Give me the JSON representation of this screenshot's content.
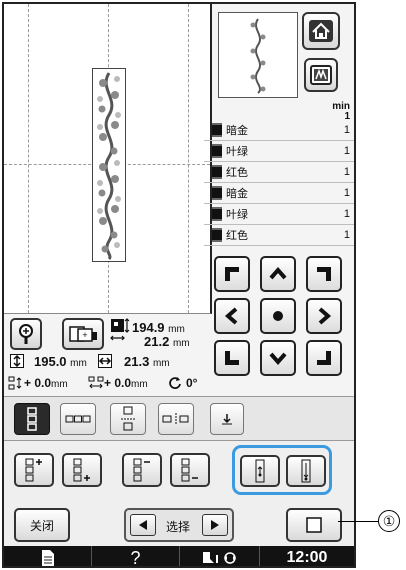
{
  "colors": {
    "accent_group_border": "#3b9ae0",
    "status_bar_bg": "#121212",
    "screen_bg": "#f4f4f4"
  },
  "icons": {
    "home": "home-icon",
    "mode": "embroidery-mode-icon",
    "magnifier": "magnifier-icon",
    "preview": "preview-icon",
    "pattern_size": "pattern-size-icon",
    "height": "vertical-size-icon",
    "width": "horizontal-size-icon",
    "spacing_v": "vertical-spacing-icon",
    "spacing_h": "horizontal-spacing-icon",
    "rotate": "rotate-icon",
    "status_doc": "document-icon",
    "status_help": "help-icon",
    "status_sensor": "presser-foot-sensor-icon"
  },
  "color_list": {
    "min_label": "min",
    "total_min": "1",
    "rows": [
      {
        "name": "暗金",
        "minutes": "1"
      },
      {
        "name": "叶绿",
        "minutes": "1"
      },
      {
        "name": "红色",
        "minutes": "1"
      },
      {
        "name": "暗金",
        "minutes": "1"
      },
      {
        "name": "叶绿",
        "minutes": "1"
      },
      {
        "name": "红色",
        "minutes": "1"
      }
    ]
  },
  "pattern_size": {
    "height": "194.9",
    "width": "21.2",
    "unit": "mm"
  },
  "dimensions": {
    "height_value": "195.0",
    "height_unit": "mm",
    "width_value": "21.3",
    "width_unit": "mm"
  },
  "spacing": {
    "plus1": "+",
    "v_value": "0.0",
    "v_unit": "mm",
    "plus2": "+",
    "h_value": "0.0",
    "h_unit": "mm",
    "angle": "0°"
  },
  "bottom": {
    "close_label": "关闭",
    "select_label": "选择"
  },
  "status": {
    "help": "?",
    "time": "12:00"
  },
  "callout": {
    "number": "①"
  }
}
